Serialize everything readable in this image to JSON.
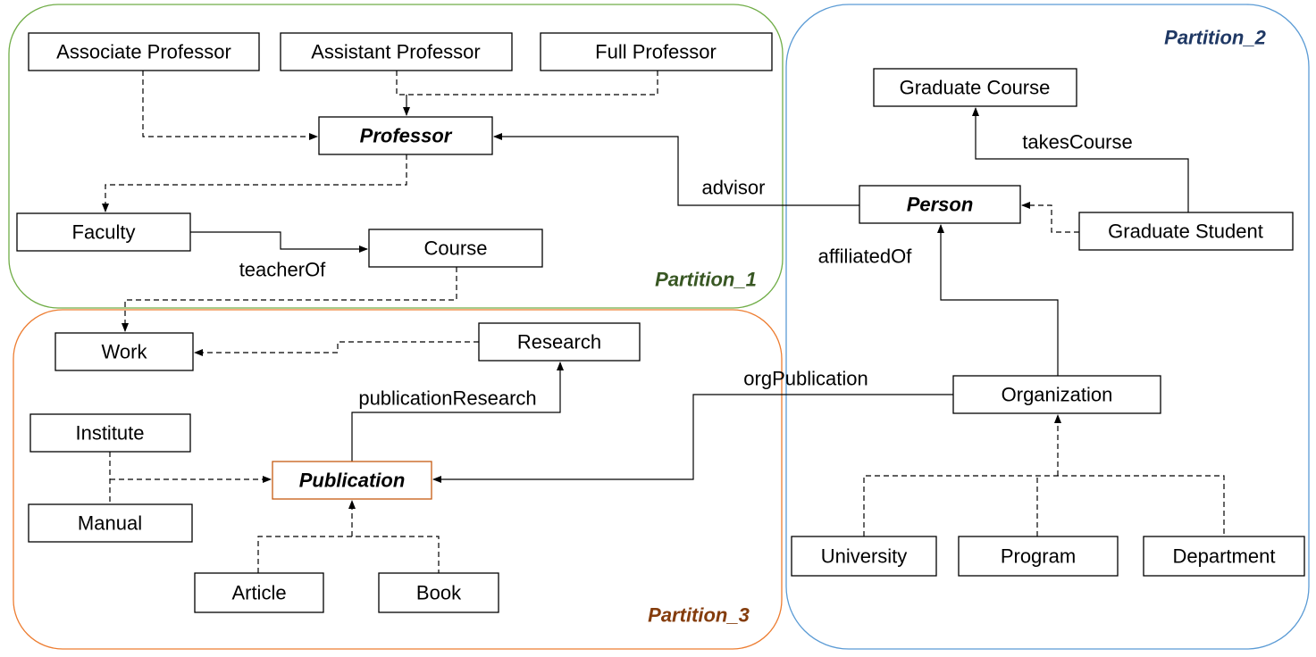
{
  "partitions": [
    {
      "label": "Partition_1",
      "color": "#70ad47",
      "text_color": "#385723"
    },
    {
      "label": "Partition_2",
      "color": "#5b9bd5",
      "text_color": "#1f3864"
    },
    {
      "label": "Partition_3",
      "color": "#ed7d31",
      "text_color": "#843c0c"
    }
  ],
  "classes": {
    "associate_professor": "Associate Professor",
    "assistant_professor": "Assistant Professor",
    "full_professor": "Full Professor",
    "professor": "Professor",
    "faculty": "Faculty",
    "course": "Course",
    "work": "Work",
    "research": "Research",
    "institute": "Institute",
    "manual": "Manual",
    "publication": "Publication",
    "article": "Article",
    "book": "Book",
    "graduate_course": "Graduate Course",
    "person": "Person",
    "graduate_student": "Graduate Student",
    "organization": "Organization",
    "university": "University",
    "program": "Program",
    "department": "Department"
  },
  "relations": {
    "advisor": "advisor",
    "teacher_of": "teacherOf",
    "takes_course": "takesCourse",
    "affiliated_of": "affiliatedOf",
    "org_publication": "orgPublication",
    "publication_research": "publicationResearch"
  }
}
